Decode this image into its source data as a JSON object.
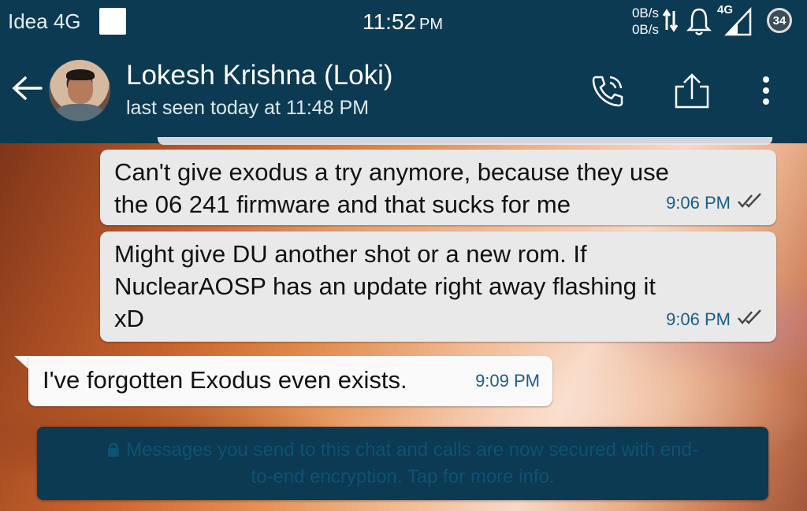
{
  "status_bar": {
    "carrier": "Idea 4G",
    "time": "11:52",
    "time_suffix": "PM",
    "upload_speed": "0B/s",
    "download_speed": "0B/s",
    "network_type": "4G",
    "battery_level": "34",
    "icons": [
      "data-activity-icon",
      "bell-icon",
      "signal-icon",
      "battery-icon"
    ]
  },
  "header": {
    "contact_name": "Lokesh Krishna (Loki)",
    "last_seen": "last seen today at 11:48 PM",
    "icons": [
      "back-arrow-icon",
      "call-icon",
      "share-icon",
      "more-vert-icon"
    ]
  },
  "messages": [
    {
      "direction": "out",
      "lines": [
        "Can't give exodus a try anymore, because they use",
        "the 06 241 firmware and that sucks for me"
      ],
      "time": "9:06 PM",
      "status": "read-double-check"
    },
    {
      "direction": "out",
      "lines": [
        "Might give DU another shot or a new rom. If",
        "NuclearAOSP has an update right away flashing it",
        "xD"
      ],
      "time": "9:06 PM",
      "status": "read-double-check"
    },
    {
      "direction": "in",
      "lines": [
        "I've forgotten Exodus even exists."
      ],
      "time": "9:09 PM"
    }
  ],
  "encryption_notice": {
    "line1": "Messages you send to this chat and calls are now secured with end-",
    "line2": "to-end encryption. Tap for more info."
  },
  "colors": {
    "header_bg": "#0b3a52",
    "bubble_out": "#e9e9e9",
    "bubble_in": "#fafafa",
    "meta_text": "#1a5d85"
  }
}
